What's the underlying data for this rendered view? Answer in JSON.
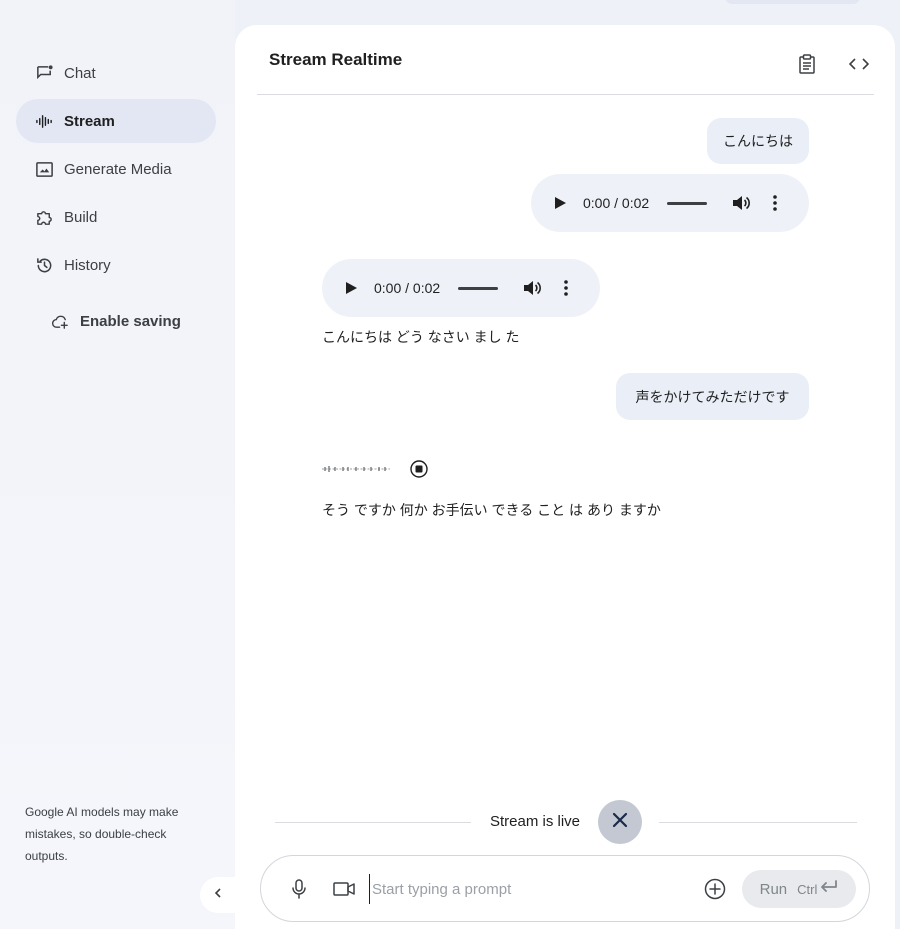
{
  "sidebar": {
    "items": [
      {
        "label": "Chat",
        "icon": "chat-icon"
      },
      {
        "label": "Stream",
        "icon": "waveform-icon",
        "active": true
      },
      {
        "label": "Generate Media",
        "icon": "image-icon"
      },
      {
        "label": "Build",
        "icon": "puzzle-icon"
      },
      {
        "label": "History",
        "icon": "history-icon"
      }
    ],
    "enable_saving": "Enable saving",
    "disclaimer": "Google AI models may make mistakes, so double-check outputs."
  },
  "header": {
    "title": "Stream Realtime"
  },
  "conversation": {
    "user_1": "こんにちは",
    "user_audio_time": "0:00 / 0:02",
    "model_audio_time": "0:00 / 0:02",
    "model_1": "こんにちは どう なさい まし た",
    "user_2": "声をかけてみただけです",
    "model_2": "そう ですか 何か お手伝い できる こと は あり ますか"
  },
  "live": {
    "status": "Stream is live"
  },
  "composer": {
    "placeholder": "Start typing a prompt",
    "run_label": "Run",
    "shortcut": "Ctrl"
  },
  "colors": {
    "accent": "#e2e7f3",
    "bubble": "#e9eef7",
    "background": "#eef1f8"
  }
}
